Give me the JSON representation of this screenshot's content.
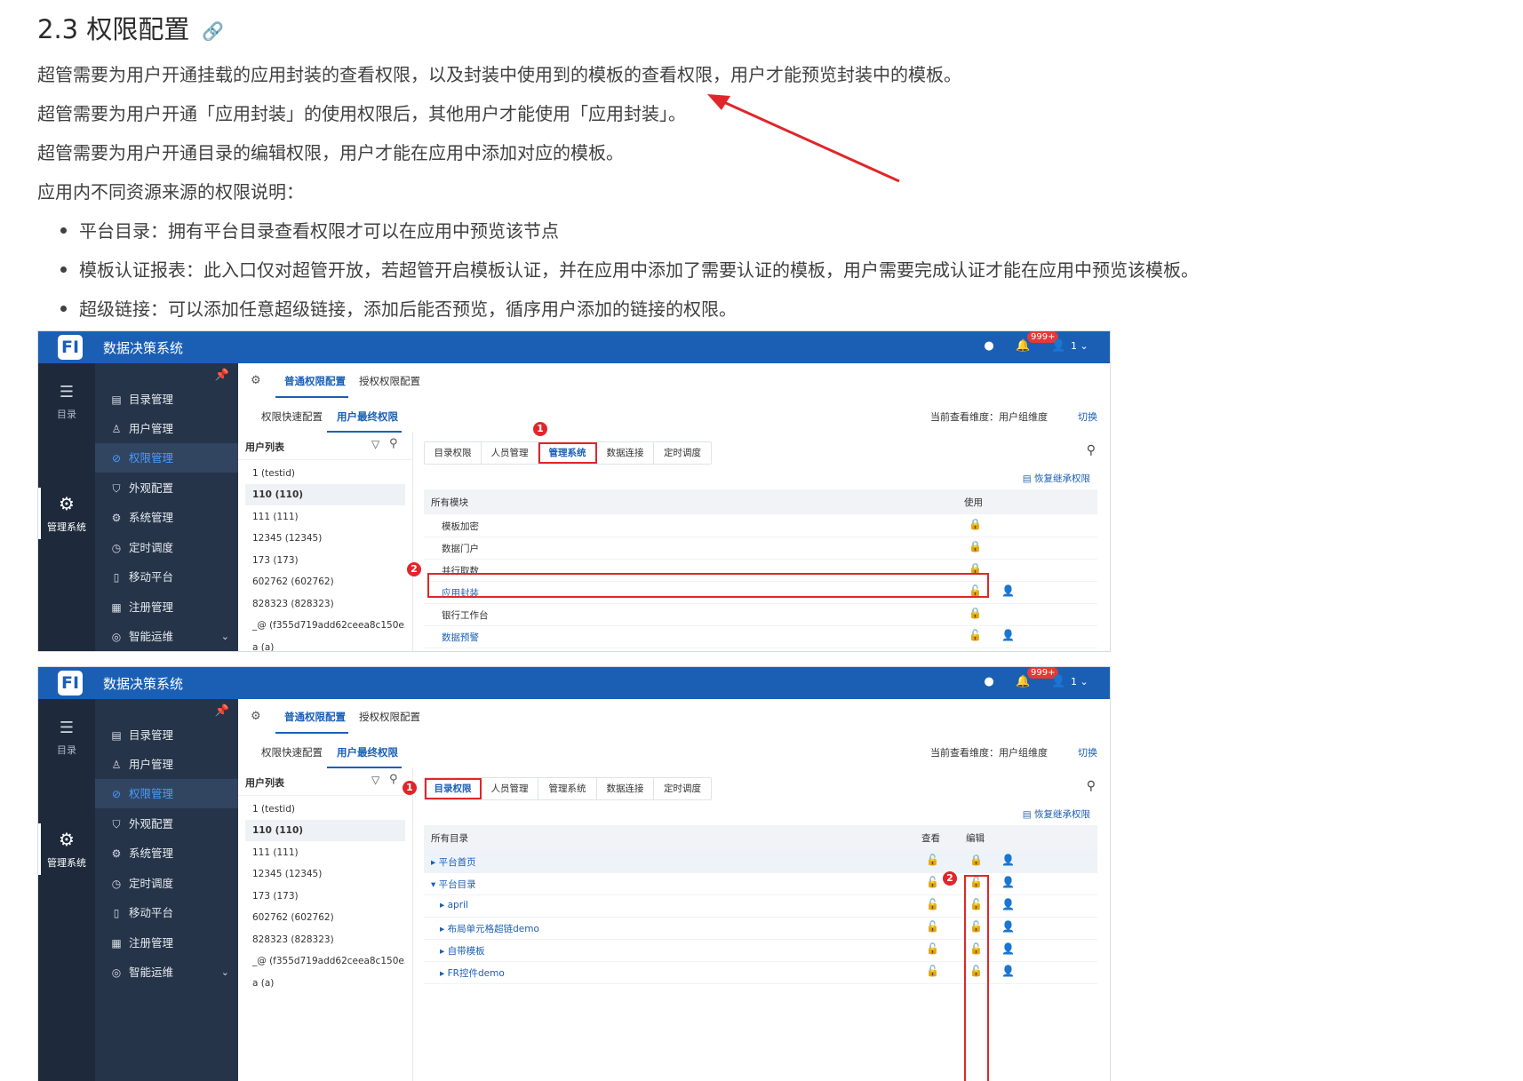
{
  "section": {
    "title": "2.3 权限配置",
    "paragraphs": [
      "超管需要为用户开通挂载的应用封装的查看权限，以及封装中使用到的模板的查看权限，用户才能预览封装中的模板。",
      "超管需要为用户开通「应用封装」的使用权限后，其他用户才能使用「应用封装」。",
      "超管需要为用户开通目录的编辑权限，用户才能在应用中添加对应的模板。",
      "应用内不同资源来源的权限说明："
    ],
    "bullets": [
      "平台目录：拥有平台目录查看权限才可以在应用中预览该节点",
      "模板认证报表：此入口仅对超管开放，若超管开启模板认证，并在应用中添加了需要认证的模板，用户需要完成认证才能在应用中预览该模板。",
      "超级链接：可以添加任意超级链接，添加后能否预览，循序用户添加的链接的权限。"
    ]
  },
  "app": {
    "title": "数据决策系统",
    "logo": "FI",
    "badge": "999+",
    "user": "1",
    "left_items": [
      "目录",
      "管理系统"
    ],
    "nav": [
      "目录管理",
      "用户管理",
      "权限管理",
      "外观配置",
      "系统管理",
      "定时调度",
      "移动平台",
      "注册管理",
      "智能运维"
    ],
    "tabs": [
      "普通权限配置",
      "授权权限配置"
    ],
    "subtabs": [
      "权限快速配置",
      "用户最终权限"
    ],
    "dimension": "当前查看维度：用户组维度",
    "switch": "切换",
    "user_list_title": "用户列表",
    "users": [
      "1 (testid)",
      "110 (110)",
      "111 (111)",
      "12345 (12345)",
      "173 (173)",
      "602762 (602762)",
      "828323 (828323)",
      "_@ (f355d719add62ceea8c150e5f...",
      "a (a)"
    ],
    "perm_tabs": [
      "目录权限",
      "人员管理",
      "管理系统",
      "数据连接",
      "定时调度"
    ],
    "restore": "恢复继承权限"
  },
  "shot1": {
    "col_name": "所有模块",
    "col_use": "使用",
    "rows": [
      {
        "name": "模板加密",
        "user": ""
      },
      {
        "name": "数据门户",
        "user": ""
      },
      {
        "name": "并行取数",
        "user": ""
      },
      {
        "name": "应用封装",
        "user": "yellow"
      },
      {
        "name": "银行工作台",
        "user": ""
      },
      {
        "name": "数据预警",
        "user": "yellow"
      }
    ],
    "markers": [
      "1",
      "2"
    ]
  },
  "shot2": {
    "col_name": "所有目录",
    "col_view": "查看",
    "col_edit": "编辑",
    "rows": [
      {
        "name": "平台首页",
        "indent": 0,
        "caret": "▸"
      },
      {
        "name": "平台目录",
        "indent": 0,
        "caret": "▾"
      },
      {
        "name": "april",
        "indent": 1,
        "caret": "▸"
      },
      {
        "name": "布局单元格超链demo",
        "indent": 1,
        "caret": "▸"
      },
      {
        "name": "自带模板",
        "indent": 1,
        "caret": "▸"
      },
      {
        "name": "FR控件demo",
        "indent": 1,
        "caret": "▸"
      }
    ],
    "markers": [
      "1",
      "2"
    ]
  },
  "colors": {
    "brand": "#1b5fb5",
    "sidebar": "#253449",
    "annotation": "#e0262a"
  }
}
